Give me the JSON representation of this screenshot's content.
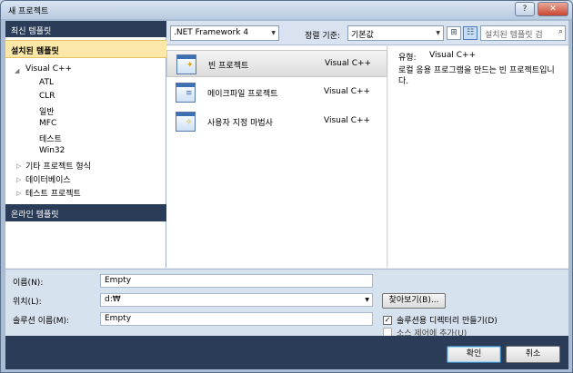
{
  "window": {
    "title": "새 프로젝트",
    "help_label": "?",
    "close_label": "✕"
  },
  "left_panel": {
    "recent_header": "최신 템플릿",
    "installed_header": "설치된 템플릿",
    "tree": {
      "root_label": "Visual C++",
      "children": [
        "ATL",
        "CLR",
        "일반",
        "MFC",
        "테스트",
        "Win32"
      ],
      "other_items": [
        "기타 프로젝트 형식",
        "데이터베이스",
        "테스트 프로젝트"
      ]
    },
    "online_header": "온라인 템플릿"
  },
  "toolbar": {
    "framework": ".NET Framework 4",
    "sort_label": "정렬 기준:",
    "sort_value": "기본값",
    "search_placeholder": "설치된 템플릿 검"
  },
  "templates": [
    {
      "name": "빈 프로젝트",
      "language": "Visual C++",
      "icon": "empty-project-icon"
    },
    {
      "name": "메이크파일 프로젝트",
      "language": "Visual C++",
      "icon": "makefile-project-icon"
    },
    {
      "name": "사용자 지정 마법사",
      "language": "Visual C++",
      "icon": "custom-wizard-icon"
    }
  ],
  "details": {
    "type_label": "유형:",
    "type_value": "Visual C++",
    "description": "로컬 응용 프로그램을 만드는 빈 프로젝트입니다."
  },
  "form": {
    "name_label": "이름(N):",
    "name_value": "Empty",
    "location_label": "위치(L):",
    "location_value": "d:₩",
    "browse_label": "찾아보기(B)...",
    "solution_label": "솔루션 이름(M):",
    "solution_value": "Empty",
    "create_dir_label": "솔루션용 디렉터리 만들기(D)",
    "create_dir_checked": "✓",
    "source_control_label": "소스 제어에 추가(U)"
  },
  "buttons": {
    "ok": "확인",
    "cancel": "취소"
  }
}
